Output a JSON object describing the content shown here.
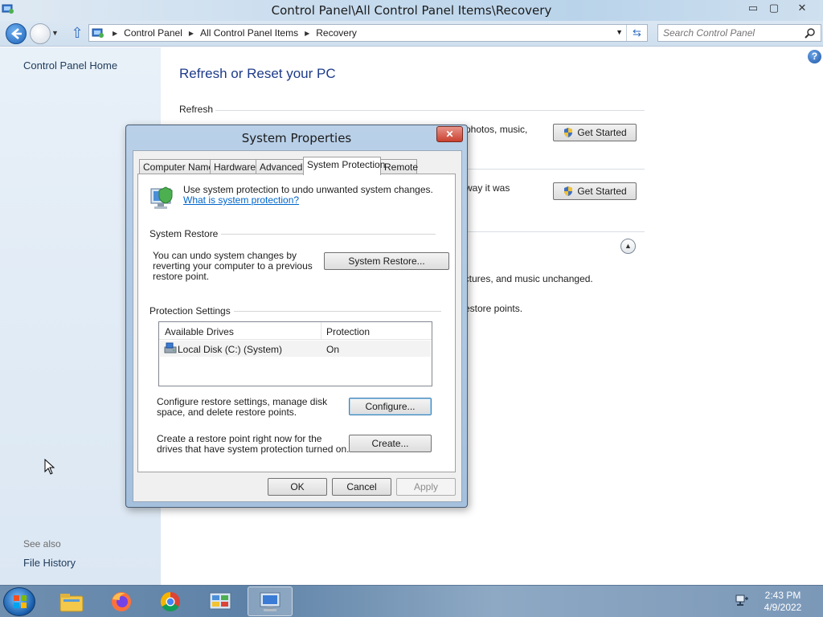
{
  "window": {
    "title": "Control Panel\\All Control Panel Items\\Recovery",
    "controls": {
      "minimize": "▭",
      "maximize": "▢",
      "close": "✕"
    }
  },
  "address_bar": {
    "crumbs": [
      "Control Panel",
      "All Control Panel Items",
      "Recovery"
    ],
    "search_placeholder": "Search Control Panel"
  },
  "sidebar": {
    "home_link": "Control Panel Home",
    "see_also_label": "See also",
    "file_history_link": "File History"
  },
  "main": {
    "page_title": "Refresh or Reset your PC",
    "refresh_label": "Refresh",
    "refresh_text_fragment": "photos, music,",
    "reset_text_fragment": "way it was",
    "get_started_label": "Get Started",
    "advanced_text_1": "ictures, and music unchanged.",
    "advanced_text_2": "estore points."
  },
  "dialog": {
    "title": "System Properties",
    "close_label": "✕",
    "tabs": [
      {
        "label": "Computer Name",
        "active": false
      },
      {
        "label": "Hardware",
        "active": false
      },
      {
        "label": "Advanced",
        "active": false
      },
      {
        "label": "System Protection",
        "active": true
      },
      {
        "label": "Remote",
        "active": false
      }
    ],
    "intro_text": "Use system protection to undo unwanted system changes.",
    "intro_link": "What is system protection?",
    "system_restore": {
      "label": "System Restore",
      "text": "You can undo system changes by reverting your computer to a previous restore point.",
      "button": "System Restore..."
    },
    "protection_settings": {
      "label": "Protection Settings",
      "columns": [
        "Available Drives",
        "Protection"
      ],
      "rows": [
        {
          "drive": "Local Disk (C:) (System)",
          "protection": "On"
        }
      ],
      "configure_text": "Configure restore settings, manage disk space, and delete restore points.",
      "configure_button": "Configure...",
      "create_text": "Create a restore point right now for the drives that have system protection turned on.",
      "create_button": "Create..."
    },
    "footer": {
      "ok": "OK",
      "cancel": "Cancel",
      "apply": "Apply"
    }
  },
  "taskbar": {
    "items": [
      "file-explorer-icon",
      "firefox-icon",
      "chrome-icon",
      "control-panel-icon",
      "system-properties-icon"
    ],
    "clock_time": "2:43 PM",
    "clock_date": "4/9/2022"
  },
  "colors": {
    "link": "#0066cc",
    "page_title": "#1e3b8a",
    "sidebar_bg": "#e2ecf6",
    "dialog_frame": "#a4c0dd",
    "close_red": "#c9412f"
  }
}
